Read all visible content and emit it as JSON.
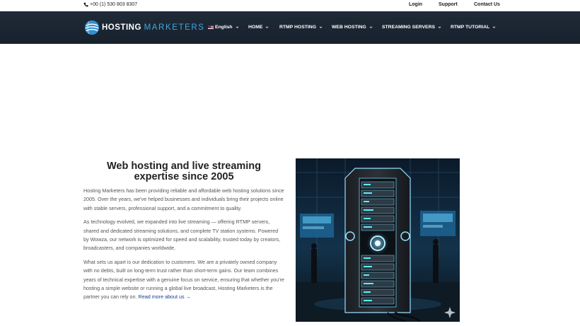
{
  "topbar": {
    "phone": "+00 (1) 530 803 8307",
    "links": [
      "Login",
      "Support",
      "Contact Us"
    ]
  },
  "logo": {
    "word1": "HOSTING",
    "word2": "MARKETERS",
    "icon": "globe-logo-icon"
  },
  "nav": {
    "language": "English",
    "items": [
      "HOME",
      "RTMP HOSTING",
      "WEB HOSTING",
      "STREAMING SERVERS",
      "RTMP TUTORIAL"
    ]
  },
  "main": {
    "heading": "Web hosting and live streaming expertise since 2005",
    "paragraphs": [
      "Hosting Marketers has been providing reliable and affordable web hosting solutions since 2005. Over the years, we've helped businesses and individuals bring their projects online with stable servers, professional support, and a commitment to quality.",
      "As technology evolved, we expanded into live streaming — offering RTMP servers, shared and dedicated streaming solutions, and complete TV station systems. Powered by Wowza, our network is optimized for speed and scalability, trusted today by creators, broadcasters, and companies worldwide.",
      "What sets us apart is our dedication to customers. We are a privately owned company with no debts, built on long-term trust rather than short-term gains. Our team combines years of technical expertise with a genuine focus on service, ensuring that whether you're hosting a simple website or running a global live broadcast, Hosting Marketers is the partner you can rely on."
    ],
    "read_more": "Read more about us →"
  },
  "colors": {
    "nav_bg": "#1f2b38",
    "accent": "#3fa7e3",
    "link": "#1c3e8f"
  }
}
